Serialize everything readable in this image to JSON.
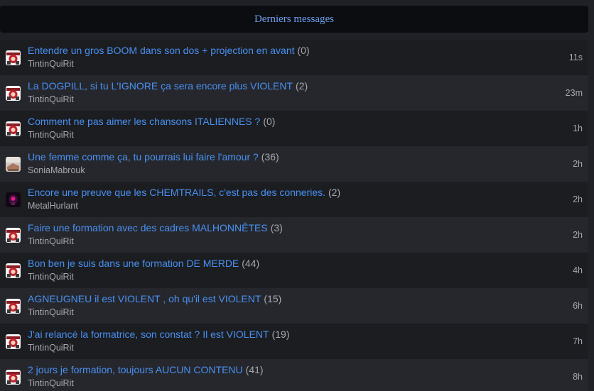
{
  "header": {
    "title": "Derniers messages"
  },
  "colors": {
    "background": "#1f2126",
    "header_background": "#0c0d10",
    "header_text": "#6fa0ee",
    "title_link": "#4a90f0",
    "meta_text": "#a6a8ae"
  },
  "topics": [
    {
      "title": "Entendre un gros BOOM dans son dos + projection en avant",
      "count": "(0)",
      "author": "TintinQuiRit",
      "time": "11s",
      "avatar": "tintin"
    },
    {
      "title": "La DOGPILL, si tu L'IGNORE ça sera encore plus VIOLENT",
      "count": "(2)",
      "author": "TintinQuiRit",
      "time": "23m",
      "avatar": "tintin"
    },
    {
      "title": "Comment ne pas aimer les chansons ITALIENNES ?",
      "count": "(0)",
      "author": "TintinQuiRit",
      "time": "1h",
      "avatar": "tintin"
    },
    {
      "title": "Une femme comme ça, tu pourrais lui faire l'amour ?",
      "count": "(36)",
      "author": "SoniaMabrouk",
      "time": "2h",
      "avatar": "sonia"
    },
    {
      "title": "Encore une preuve que les CHEMTRAILS, c'est pas des conneries.",
      "count": "(2)",
      "author": "MetalHurlant",
      "time": "2h",
      "avatar": "metal"
    },
    {
      "title": "Faire une formation avec des cadres MALHONNÊTES",
      "count": "(3)",
      "author": "TintinQuiRit",
      "time": "2h",
      "avatar": "tintin"
    },
    {
      "title": "Bon ben je suis dans une formation DE MERDE",
      "count": "(44)",
      "author": "TintinQuiRit",
      "time": "4h",
      "avatar": "tintin"
    },
    {
      "title": "AGNEUGNEU il est VIOLENT , oh qu'il est VIOLENT",
      "count": "(15)",
      "author": "TintinQuiRit",
      "time": "6h",
      "avatar": "tintin"
    },
    {
      "title": "J'ai relancé la formatrice, son constat ? Il est VIOLENT",
      "count": "(19)",
      "author": "TintinQuiRit",
      "time": "7h",
      "avatar": "tintin"
    },
    {
      "title": "2 jours je formation, toujours AUCUN CONTENU",
      "count": "(41)",
      "author": "TintinQuiRit",
      "time": "8h",
      "avatar": "tintin"
    }
  ]
}
